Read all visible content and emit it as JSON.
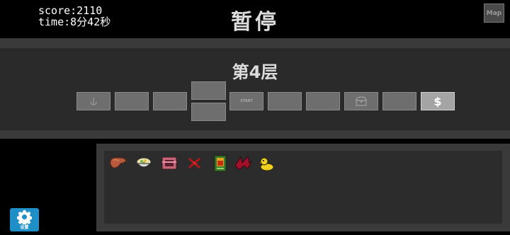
{
  "hud": {
    "score": "score:2110",
    "time": "time:8分42秒"
  },
  "title": "暂停",
  "map_button": "Map",
  "floor": {
    "label": "第4层",
    "start_room_label": "START",
    "shop_symbol": "$"
  },
  "inventory": {
    "items": [
      {
        "icon": "liver-icon"
      },
      {
        "icon": "bowl-icon"
      },
      {
        "icon": "pink-box-icon"
      },
      {
        "icon": "red-crossed-icon"
      },
      {
        "icon": "card-icon"
      },
      {
        "icon": "red-wings-icon"
      },
      {
        "icon": "rubber-duck-icon"
      }
    ]
  },
  "settings": {
    "label": "设置",
    "icon": "gear-icon"
  },
  "colors": {
    "settings_button": "#1f8fc7",
    "panel": "#3a3a3a",
    "room": "#6e6e6e",
    "current_room": "#a4a4a4"
  }
}
